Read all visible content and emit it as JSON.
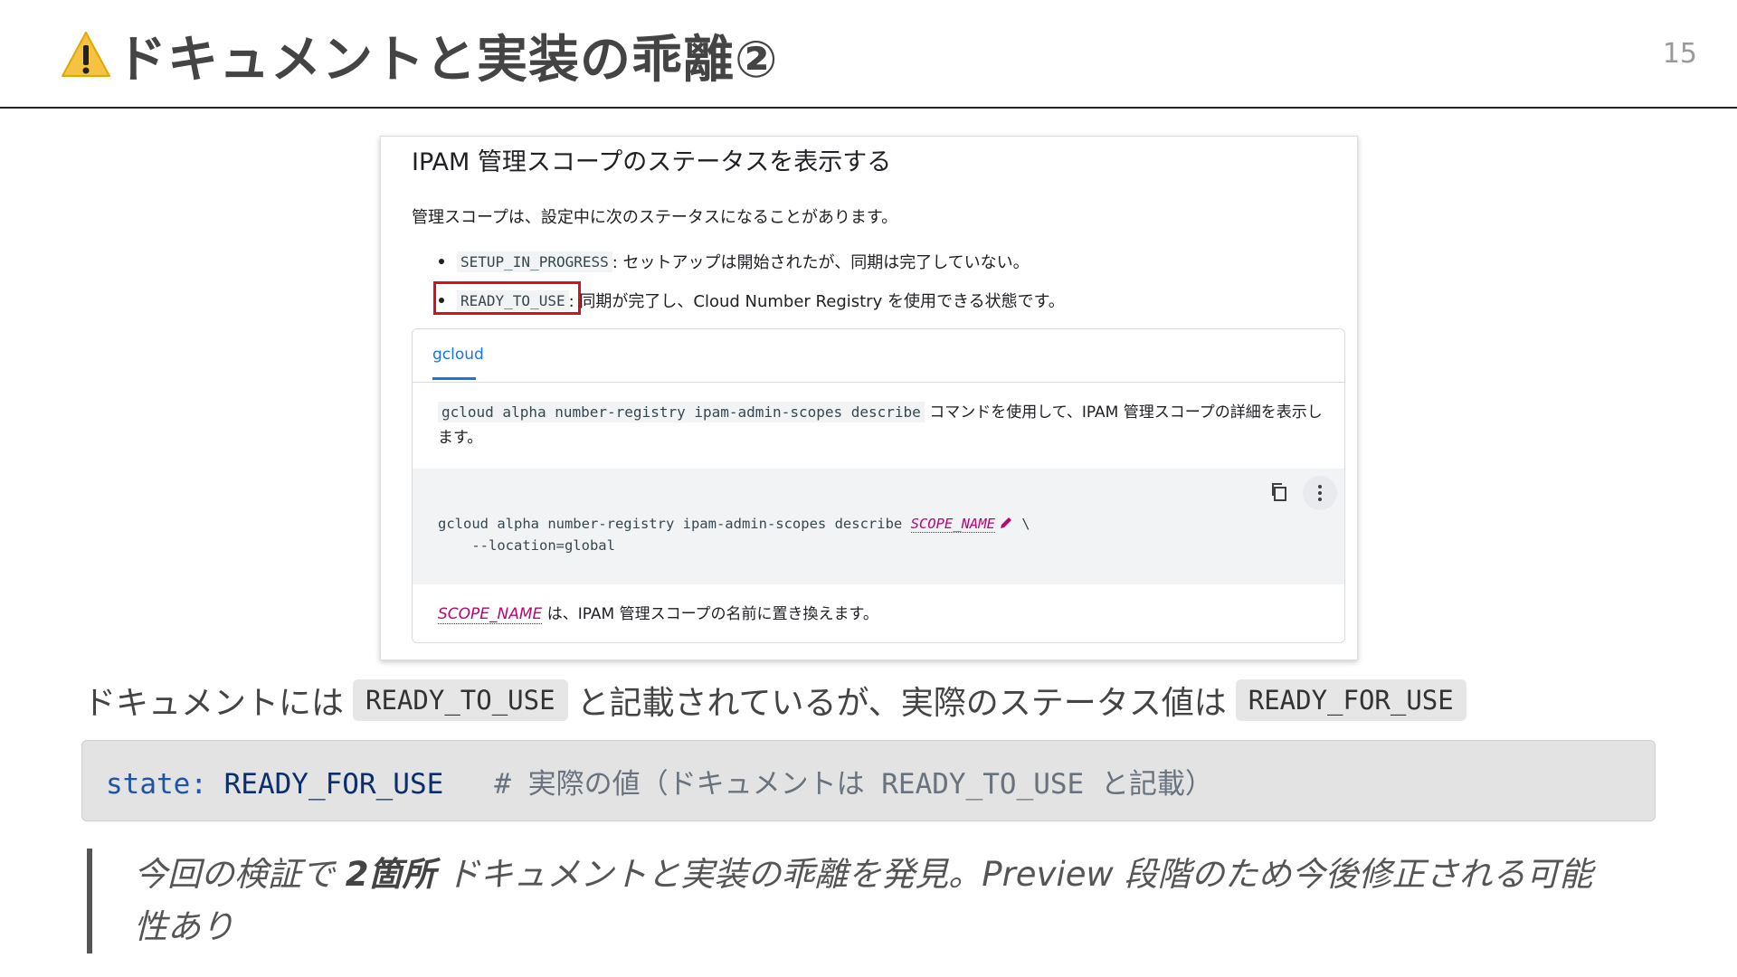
{
  "slide": {
    "title": "ドキュメントと実装の乖離②",
    "page_number": "15",
    "title_icon": "warning-icon"
  },
  "doc_screenshot": {
    "heading": "IPAM 管理スコープのステータスを表示する",
    "intro": "管理スコープは、設定中に次のステータスになることがあります。",
    "bullets": [
      {
        "code": "SETUP_IN_PROGRESS",
        "text": ": セットアップは開始されたが、同期は完了していない。"
      },
      {
        "code": "READY_TO_USE",
        "text": ": 同期が完了し、Cloud Number Registry を使用できる状態です。"
      }
    ],
    "tab_label": "gcloud",
    "card_description_code": "gcloud alpha number-registry ipam-admin-scopes describe",
    "card_description_text": " コマンドを使用して、IPAM 管理スコープの詳細を表示します。",
    "code_line_1_prefix": "gcloud alpha number-registry ipam-admin-scopes describe ",
    "code_line_1_var": "SCOPE_NAME",
    "code_line_1_suffix": " \\",
    "code_line_2": "    --location=global",
    "note_var": "SCOPE_NAME",
    "note_text": " は、IPAM 管理スコープの名前に置き換えます。"
  },
  "body": {
    "text_1": "ドキュメントには",
    "code_1": "READY_TO_USE",
    "text_2": "と記載されているが、実際のステータス値は",
    "code_2": "READY_FOR_USE"
  },
  "code_block": {
    "key": "state:",
    "value": " READY_FOR_USE",
    "comment": "   # 実際の値（ドキュメントは READY_TO_USE と記載）"
  },
  "quote": {
    "text_before": "今回の検証で ",
    "emphasis": "2箇所",
    "text_after": " ドキュメントと実装の乖離を発見。Preview 段階のため今後修正される可能性あり"
  },
  "colors": {
    "accent_red": "#d3121d",
    "link_blue": "#1a73e8",
    "variable_magenta": "#b80672"
  }
}
